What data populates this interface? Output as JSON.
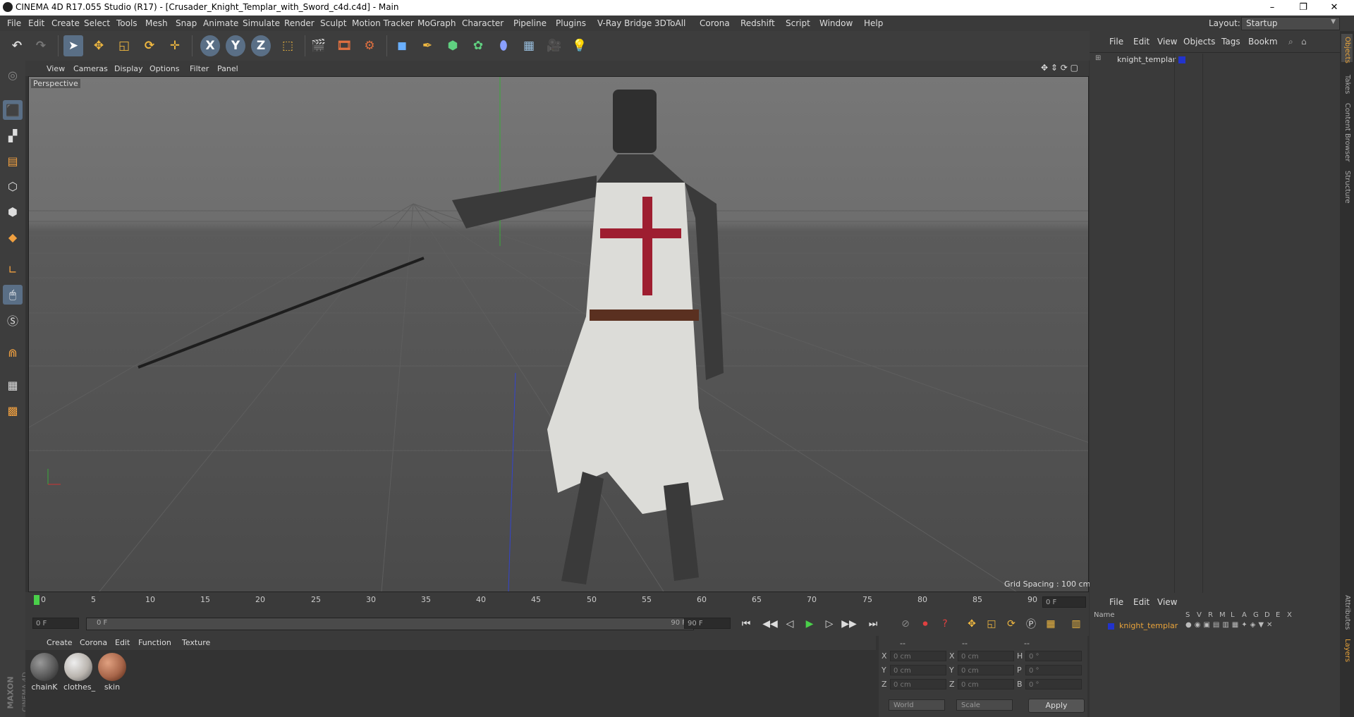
{
  "window": {
    "title": "CINEMA 4D R17.055 Studio (R17) - [Crusader_Knight_Templar_with_Sword_c4d.c4d] - Main",
    "minimize": "–",
    "maximize": "❐",
    "close": "✕"
  },
  "menubar": [
    "File",
    "Edit",
    "Create",
    "Select",
    "Tools",
    "Mesh",
    "Snap",
    "Animate",
    "Simulate",
    "Render",
    "Sculpt",
    "Motion Tracker",
    "MoGraph",
    "Character",
    "Pipeline",
    "Plugins",
    "V-Ray Bridge",
    "3DToAll",
    "Corona",
    "Redshift",
    "Script",
    "Window",
    "Help"
  ],
  "layout": {
    "label": "Layout:",
    "value": "Startup"
  },
  "toolbar": {
    "x": "X",
    "y": "Y",
    "z": "Z"
  },
  "viewport": {
    "menu": [
      "View",
      "Cameras",
      "Display",
      "Options",
      "Filter",
      "Panel"
    ],
    "label": "Perspective",
    "grid_spacing": "Grid Spacing : 100 cm"
  },
  "timeline": {
    "ticks": [
      "0",
      "5",
      "10",
      "15",
      "20",
      "25",
      "30",
      "35",
      "40",
      "45",
      "50",
      "55",
      "60",
      "65",
      "70",
      "75",
      "80",
      "85",
      "90"
    ],
    "current_frame": "0 F",
    "start_field": "0 F",
    "range_start": "0 F",
    "range_end": "90 F",
    "end_field": "90 F"
  },
  "materials": {
    "menu": [
      "Create",
      "Corona",
      "Edit",
      "Function",
      "Texture"
    ],
    "items": [
      {
        "name": "chainK",
        "color": "#5a5a5a"
      },
      {
        "name": "clothes_",
        "color": "#b9b4ae"
      },
      {
        "name": "skin",
        "color": "#a8664a"
      }
    ]
  },
  "coords": {
    "headers": [
      "--",
      "--",
      "--"
    ],
    "rows": [
      {
        "a": "X",
        "av": "0 cm",
        "b": "X",
        "bv": "0 cm",
        "c": "H",
        "cv": "0 °"
      },
      {
        "a": "Y",
        "av": "0 cm",
        "b": "Y",
        "bv": "0 cm",
        "c": "P",
        "cv": "0 °"
      },
      {
        "a": "Z",
        "av": "0 cm",
        "b": "Z",
        "bv": "0 cm",
        "c": "B",
        "cv": "0 °"
      }
    ],
    "world": "World",
    "scale": "Scale",
    "apply": "Apply"
  },
  "objects": {
    "menu": [
      "File",
      "Edit",
      "View",
      "Objects",
      "Tags",
      "Bookm"
    ],
    "item": "knight_templar"
  },
  "layers": {
    "menu": [
      "File",
      "Edit",
      "View"
    ],
    "col_name": "Name",
    "cols": [
      "S",
      "V",
      "R",
      "M",
      "L",
      "A",
      "G",
      "D",
      "E",
      "X"
    ],
    "item": "knight_templar"
  },
  "side_tabs": [
    "Objects",
    "Takes",
    "Content Browser",
    "Structure"
  ],
  "side_tabs_bottom": [
    "Attributes",
    "Layers"
  ],
  "brand": {
    "line1": "MAXON",
    "line2": "CINEMA 4D"
  },
  "colors": {
    "accent": "#5a6f86",
    "object_orange": "#e8a33a",
    "layer_blue": "#2233cc"
  }
}
